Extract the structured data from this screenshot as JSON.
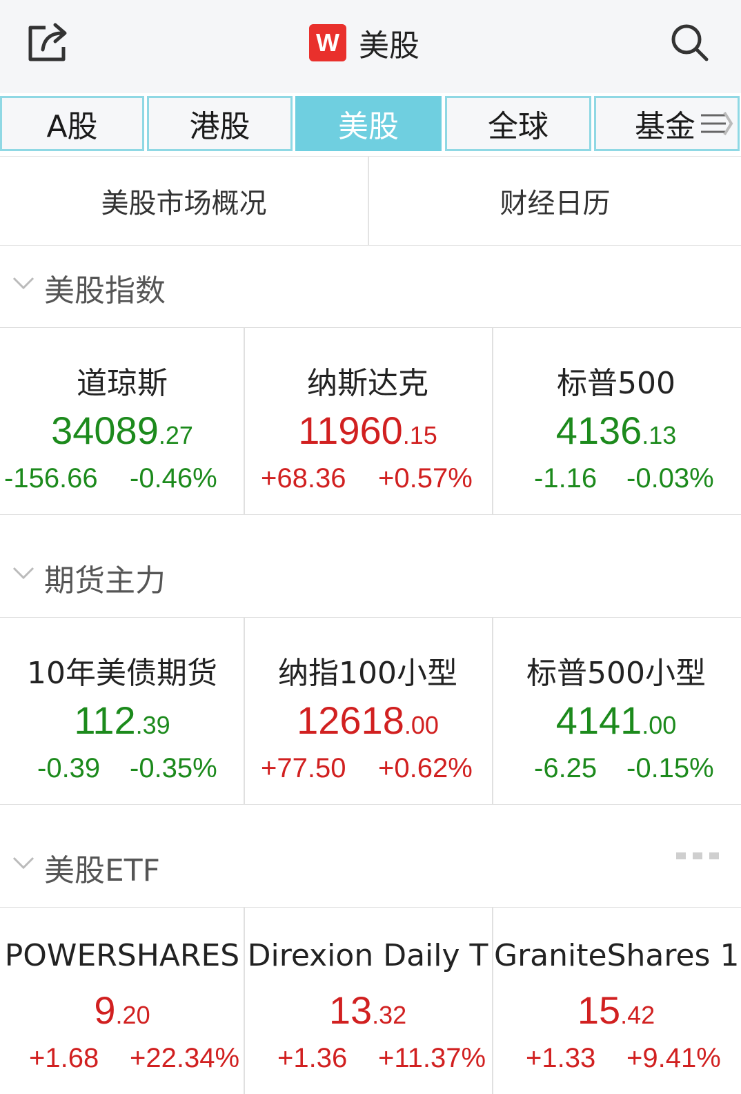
{
  "header": {
    "logo_letter": "W",
    "title": "美股",
    "icons": [
      "share-icon",
      "search-icon"
    ],
    "logo_color": "#e9302c"
  },
  "tabs": [
    {
      "label": "A股",
      "active": false
    },
    {
      "label": "港股",
      "active": false
    },
    {
      "label": "美股",
      "active": true
    },
    {
      "label": "全球",
      "active": false
    },
    {
      "label": "基金",
      "active": false
    }
  ],
  "subbar": {
    "left": "美股市场概况",
    "right": "财经日历"
  },
  "sections": [
    {
      "title": "美股指数",
      "items": [
        {
          "name": "道琼斯",
          "price_int": "34089",
          "price_dec": ".27",
          "change": "-156.66",
          "pct": "-0.46%",
          "dir": "down"
        },
        {
          "name": "纳斯达克",
          "price_int": "11960",
          "price_dec": ".15",
          "change": "+68.36",
          "pct": "+0.57%",
          "dir": "up"
        },
        {
          "name": "标普500",
          "price_int": "4136",
          "price_dec": ".13",
          "change": "-1.16",
          "pct": "-0.03%",
          "dir": "down"
        }
      ]
    },
    {
      "title": "期货主力",
      "items": [
        {
          "name": "10年美债期货",
          "price_int": "112",
          "price_dec": ".39",
          "change": "-0.39",
          "pct": "-0.35%",
          "dir": "down"
        },
        {
          "name": "纳指100小型",
          "price_int": "12618",
          "price_dec": ".00",
          "change": "+77.50",
          "pct": "+0.62%",
          "dir": "up"
        },
        {
          "name": "标普500小型",
          "price_int": "4141",
          "price_dec": ".00",
          "change": "-6.25",
          "pct": "-0.15%",
          "dir": "down"
        }
      ]
    },
    {
      "title": "美股ETF",
      "items": [
        {
          "name": "POWERSHARES",
          "price_int": "9",
          "price_dec": ".20",
          "change": "+1.68",
          "pct": "+22.34%",
          "dir": "up"
        },
        {
          "name": "Direxion Daily T",
          "price_int": "13",
          "price_dec": ".32",
          "change": "+1.36",
          "pct": "+11.37%",
          "dir": "up"
        },
        {
          "name": "GraniteShares 1",
          "price_int": "15",
          "price_dec": ".42",
          "change": "+1.33",
          "pct": "+9.41%",
          "dir": "up"
        }
      ]
    }
  ],
  "colors": {
    "up": "#d12020",
    "down": "#1c8a1c",
    "tab_active": "#6fcfe0"
  }
}
